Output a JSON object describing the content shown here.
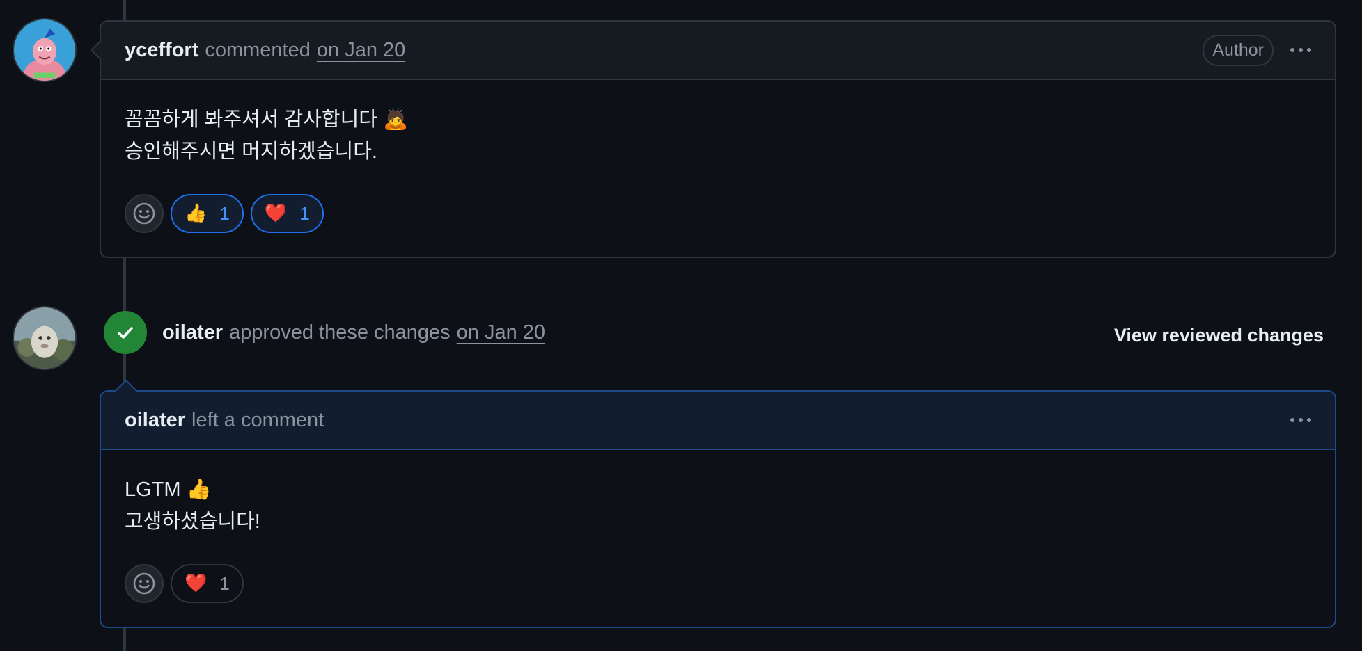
{
  "colors": {
    "background": "#0d1117",
    "border": "#30363d",
    "accent_blue": "#1f6feb",
    "approved_green": "#238636"
  },
  "comment1": {
    "author": "yceffort",
    "action": "commented",
    "date": "on Jan 20",
    "badge": "Author",
    "body_lines": [
      "꼼꼼하게 봐주셔서 감사합니다 🙇",
      "승인해주시면 머지하겠습니다."
    ],
    "reactions": [
      {
        "emoji": "👍",
        "count": "1",
        "active": true
      },
      {
        "emoji": "❤️",
        "count": "1",
        "active": true
      }
    ]
  },
  "review": {
    "author": "oilater",
    "action": "approved these changes",
    "date": "on Jan 20",
    "view_changes": "View reviewed changes"
  },
  "comment2": {
    "author": "oilater",
    "action": "left a comment",
    "body_lines": [
      "LGTM 👍",
      "고생하셨습니다!"
    ],
    "reactions": [
      {
        "emoji": "❤️",
        "count": "1",
        "active": false
      }
    ]
  },
  "icons": [
    "smiley-icon",
    "kebab-icon",
    "check-icon",
    "avatar"
  ]
}
